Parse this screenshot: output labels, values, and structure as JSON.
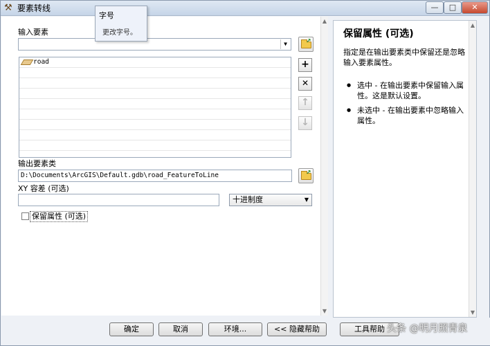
{
  "window": {
    "title": "要素转线",
    "controls": {
      "minimize": "—",
      "maximize": "□",
      "close": "✕"
    }
  },
  "tooltip": {
    "title": "字号",
    "body": "更改字号。"
  },
  "form": {
    "input_features_label": "输入要素",
    "input_features_value": "",
    "input_list_items": [
      "road"
    ],
    "output_label": "输出要素类",
    "output_value": "D:\\Documents\\ArcGIS\\Default.gdb\\road_FeatureToLine",
    "xy_tolerance_label": "XY 容差 (可选)",
    "xy_tolerance_value": "",
    "units_selected": "十进制度",
    "preserve_attributes_label": "保留属性 (可选)",
    "preserve_attributes_checked": false,
    "side_buttons": {
      "add": "+",
      "remove": "✕",
      "up": "↑",
      "down": "↓"
    }
  },
  "help": {
    "title": "保留属性 (可选)",
    "description": "指定是在输出要素类中保留还是忽略输入要素属性。",
    "items": [
      "选中 - 在输出要素中保留输入属性。这是默认设置。",
      "未选中 - 在输出要素中忽略输入属性。"
    ]
  },
  "buttons": {
    "ok": "确定",
    "cancel": "取消",
    "environments": "环境...",
    "hide_help": "<< 隐藏帮助",
    "tool_help": "工具帮助"
  },
  "watermark": "头条 @明月照青泉"
}
